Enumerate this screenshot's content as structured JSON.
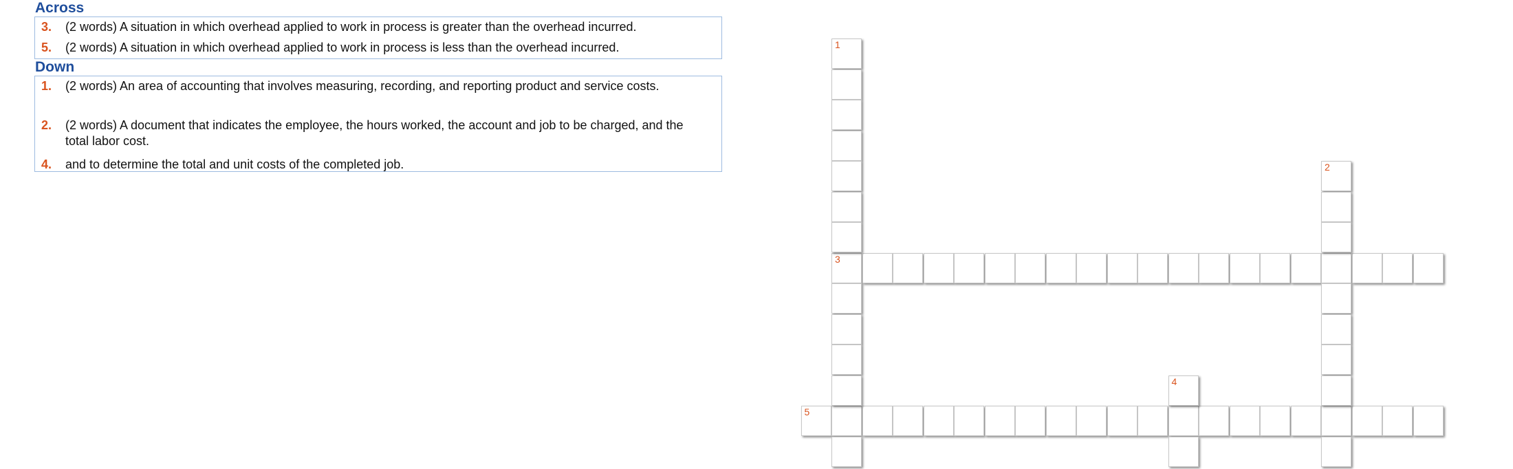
{
  "across": {
    "heading": "Across",
    "clues": [
      {
        "number": "3.",
        "text": "(2 words) A situation in which overhead applied to work in process is greater than the overhead incurred."
      },
      {
        "number": "5.",
        "text": "(2 words) A situation in which overhead applied to work in process is less than the overhead incurred."
      }
    ]
  },
  "down": {
    "heading": "Down",
    "clues": [
      {
        "number": "1.",
        "text": "(2 words) An area of accounting that involves measuring, recording, and reporting product and service costs."
      },
      {
        "number": "2.",
        "text": "(2 words) A document that indicates the employee, the hours worked, the account and job to be charged, and the total labor cost."
      },
      {
        "number": "4.",
        "text": "and to determine the total and unit costs of the completed job."
      }
    ]
  },
  "grid": {
    "cell_numbers": [
      "1",
      "2",
      "3",
      "4",
      "5"
    ],
    "accent_color": "#d9531e",
    "heading_color": "#1f4e9c"
  }
}
